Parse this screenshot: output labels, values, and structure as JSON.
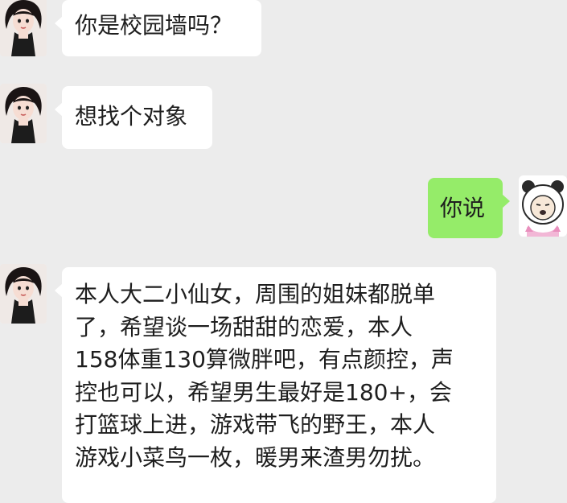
{
  "messages": [
    {
      "side": "left",
      "text": "你是校园墙吗？"
    },
    {
      "side": "left",
      "text": "想找个对象"
    },
    {
      "side": "right",
      "text": "你说"
    },
    {
      "side": "left",
      "lines": [
        "本人大二小仙女，周围的姐妹都脱单",
        "了，希望谈一场甜甜的恋爱，本人",
        "158体重130算微胖吧，有点颜控，声",
        "控也可以，希望男生最好是180+，会",
        "打篮球上进，游戏带飞的野王，本人",
        "游戏小菜鸟一枚，暖男来渣男勿扰。"
      ]
    }
  ],
  "colors": {
    "background": "#ececec",
    "received_bubble": "#ffffff",
    "sent_bubble": "#95ec69"
  },
  "icons": {
    "sender_avatar": "girl-avatar-icon",
    "self_avatar": "panda-meme-avatar-icon"
  }
}
